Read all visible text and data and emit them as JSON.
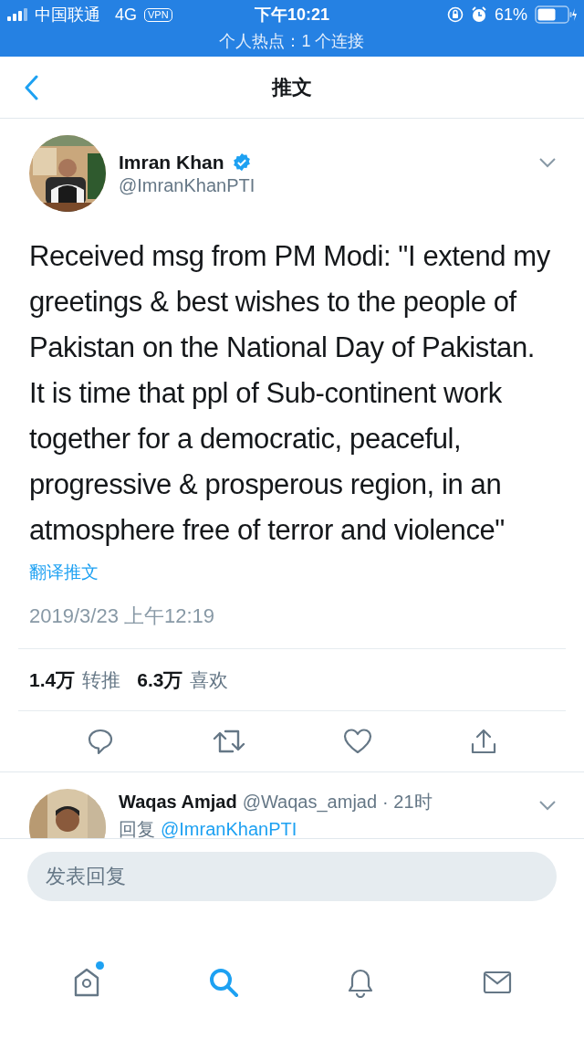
{
  "status_bar": {
    "carrier": "中国联通",
    "network": "4G",
    "vpn": "VPN",
    "time": "下午10:21",
    "battery": "61%",
    "hotspot": "个人热点：1 个连接"
  },
  "nav": {
    "title": "推文"
  },
  "tweet": {
    "author": {
      "name": "Imran Khan",
      "handle": "@ImranKhanPTI",
      "verified": true
    },
    "text": "Received msg from PM Modi: \"I extend my greetings & best wishes to the people of Pakistan on the National Day of Pakistan. It is time that ppl of Sub-continent work together for a democratic, peaceful, progressive & prosperous region, in an atmosphere free of terror and violence\"",
    "translate": "翻译推文",
    "timestamp": "2019/3/23 上午12:19",
    "stats": [
      {
        "count": "1.4万",
        "label": "转推"
      },
      {
        "count": "6.3万",
        "label": "喜欢"
      }
    ],
    "actions": [
      {
        "kind": "reply"
      },
      {
        "kind": "retweet"
      },
      {
        "kind": "like"
      },
      {
        "kind": "share"
      }
    ]
  },
  "reply": {
    "name": "Waqas Amjad",
    "handle": "@Waqas_amjad",
    "time": "· 21时",
    "replying_to": "回复",
    "mention": "@ImranKhanPTI"
  },
  "compose": {
    "placeholder": "发表回复"
  },
  "tabs": [
    {
      "kind": "home",
      "selected": false,
      "has_new": true
    },
    {
      "kind": "search",
      "selected": true,
      "has_new": false
    },
    {
      "kind": "notifications",
      "selected": false,
      "has_new": false
    },
    {
      "kind": "messages",
      "selected": false,
      "has_new": false
    }
  ]
}
